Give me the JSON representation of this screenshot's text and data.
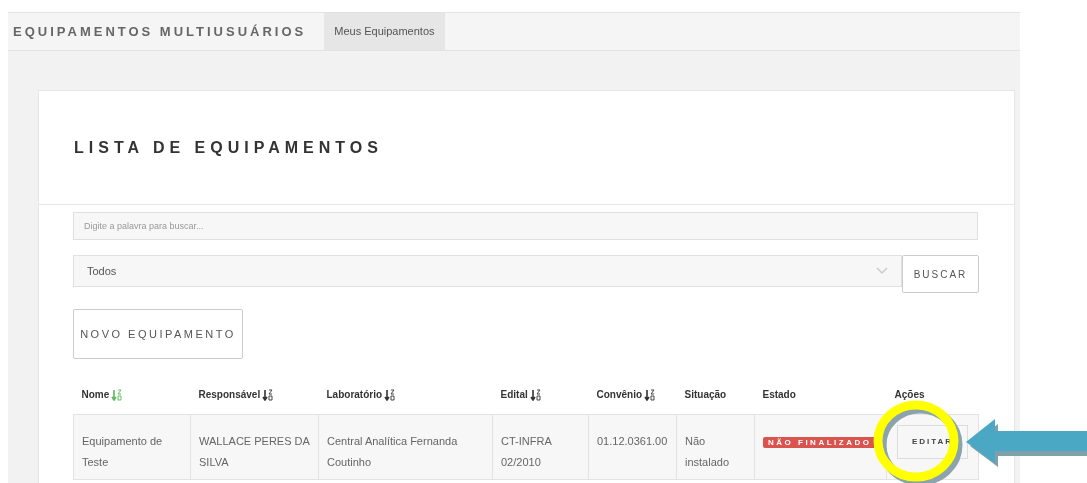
{
  "header": {
    "brand": "EQUIPAMENTOS MULTIUSUÁRIOS",
    "nav": [
      {
        "label": "Meus Equipamentos",
        "selected": true
      }
    ]
  },
  "card": {
    "title": "LISTA DE EQUIPAMENTOS"
  },
  "search": {
    "placeholder": "Digite a palavra para buscar..."
  },
  "filter": {
    "value": "Todos"
  },
  "search_button": "BUSCAR",
  "new_button": "NOVO EQUIPAMENTO",
  "table": {
    "columns": [
      {
        "label": "Nome",
        "sortable": true,
        "selected": true
      },
      {
        "label": "Responsável",
        "sortable": true,
        "selected": false
      },
      {
        "label": "Laboratório",
        "sortable": true,
        "selected": false
      },
      {
        "label": "Edital",
        "sortable": true,
        "selected": false
      },
      {
        "label": "Convênio",
        "sortable": true,
        "selected": false
      },
      {
        "label": "Situação",
        "sortable": false
      },
      {
        "label": "Estado",
        "sortable": false
      },
      {
        "label": "Ações",
        "sortable": false
      }
    ],
    "rows": [
      {
        "cells": [
          "Equipamento de Teste",
          "WALLACE PERES DA SILVA",
          "Central Analítica Fernanda Coutinho",
          "CT-INFRA 02/2010",
          "01.12.0361.00",
          "Não instalado"
        ],
        "status": {
          "label": "NÃO FINALIZADO",
          "color": "#d9534f"
        },
        "action": "EDITAR"
      }
    ]
  }
}
